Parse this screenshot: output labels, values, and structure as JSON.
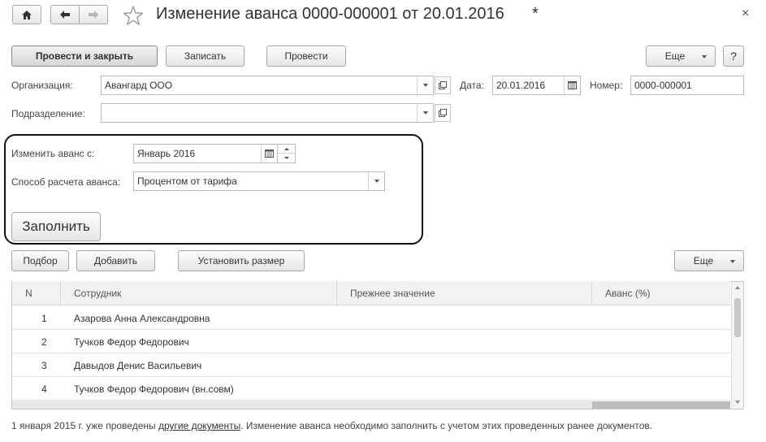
{
  "window": {
    "title": "Изменение аванса 0000-000001 от 20.01.2016",
    "modified_marker": "*",
    "close_glyph": "×"
  },
  "toolbar": {
    "post_close_label": "Провести и закрыть",
    "save_label": "Записать",
    "post_label": "Провести",
    "more_label": "Еще",
    "help_label": "?"
  },
  "form": {
    "organization_label": "Организация:",
    "organization_value": "Авангард ООО",
    "date_label": "Дата:",
    "date_value": "20.01.2016",
    "number_label": "Номер:",
    "number_value": "0000-000001",
    "division_label": "Подразделение:",
    "division_value": ""
  },
  "advance": {
    "change_from_label": "Изменить аванс с:",
    "change_from_value": "Январь 2016",
    "method_label": "Способ расчета аванса:",
    "method_value": "Процентом от тарифа",
    "fill_label": "Заполнить"
  },
  "table_toolbar": {
    "pick_label": "Подбор",
    "add_label": "Добавить",
    "set_size_label": "Установить размер",
    "more_label": "Еще"
  },
  "table": {
    "columns": [
      "N",
      "Сотрудник",
      "Прежнее значение",
      "Аванс (%)"
    ],
    "rows": [
      {
        "n": "1",
        "employee": "Азарова Анна Александровна",
        "previous": "",
        "advance": ""
      },
      {
        "n": "2",
        "employee": "Тучков Федор Федорович",
        "previous": "",
        "advance": ""
      },
      {
        "n": "3",
        "employee": "Давыдов Денис Васильевич",
        "previous": "",
        "advance": ""
      },
      {
        "n": "4",
        "employee": "Тучков Федор Федорович (вн.совм)",
        "previous": "",
        "advance": ""
      }
    ]
  },
  "footer": {
    "text_before": "1 января 2015 г.  уже проведены ",
    "link_text": "другие документы",
    "text_after": ". Изменение аванса необходимо заполнить с учетом этих проведенных ранее документов."
  },
  "icons": {
    "home": "home-icon",
    "back": "arrow-left-icon",
    "forward": "arrow-right-icon",
    "favorite": "star-icon",
    "calendar": "calendar-icon",
    "open": "open-form-icon"
  }
}
